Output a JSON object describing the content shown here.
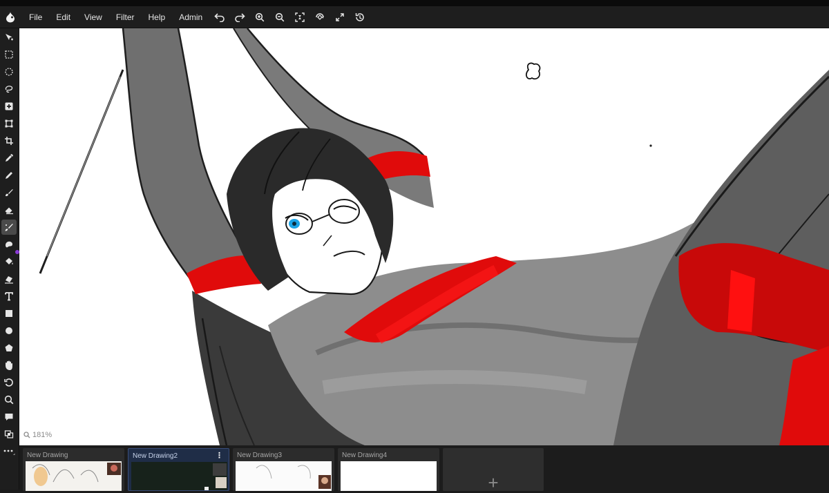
{
  "menubar": {
    "items": [
      "File",
      "Edit",
      "View",
      "Filter",
      "Help",
      "Admin"
    ]
  },
  "toolbar": {
    "tools": [
      "move",
      "select-rect",
      "select-ellipse",
      "lasso",
      "plus",
      "transform",
      "crop",
      "eyedropper",
      "pen",
      "brush",
      "eraser",
      "smudge",
      "blur",
      "fill",
      "gradient",
      "text",
      "rectangle",
      "ellipse",
      "polygon",
      "hand",
      "rotate",
      "zoom",
      "comment",
      "layers",
      "more"
    ],
    "active_tool": "smudge",
    "accent_color": "#8a3ad6"
  },
  "status": {
    "zoom": "181%"
  },
  "tabs": [
    {
      "label": "New Drawing"
    },
    {
      "label": "New Drawing2",
      "active": true
    },
    {
      "label": "New Drawing3"
    },
    {
      "label": "New Drawing4"
    }
  ],
  "new_tab": {
    "label": "+"
  },
  "colors": {
    "red": "#e00b0b",
    "iris": "#1ba3e6",
    "ui_bg": "#1e1e1e",
    "active_tab": "#1f2d47"
  }
}
